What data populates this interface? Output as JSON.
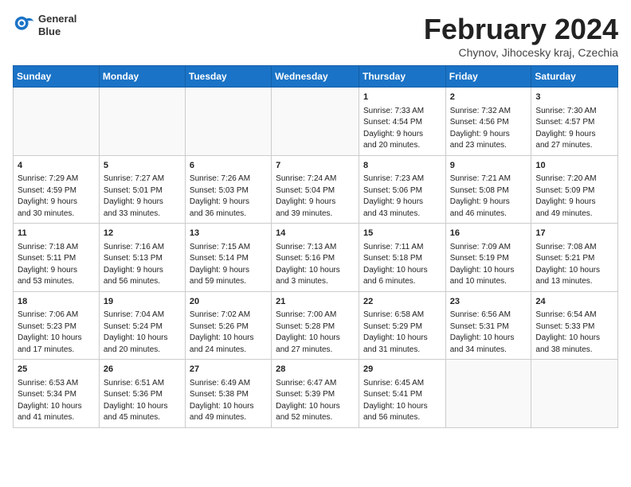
{
  "header": {
    "logo_line1": "General",
    "logo_line2": "Blue",
    "month_year": "February 2024",
    "location": "Chynov, Jihocesky kraj, Czechia"
  },
  "weekdays": [
    "Sunday",
    "Monday",
    "Tuesday",
    "Wednesday",
    "Thursday",
    "Friday",
    "Saturday"
  ],
  "weeks": [
    [
      {
        "day": "",
        "info": ""
      },
      {
        "day": "",
        "info": ""
      },
      {
        "day": "",
        "info": ""
      },
      {
        "day": "",
        "info": ""
      },
      {
        "day": "1",
        "info": "Sunrise: 7:33 AM\nSunset: 4:54 PM\nDaylight: 9 hours\nand 20 minutes."
      },
      {
        "day": "2",
        "info": "Sunrise: 7:32 AM\nSunset: 4:56 PM\nDaylight: 9 hours\nand 23 minutes."
      },
      {
        "day": "3",
        "info": "Sunrise: 7:30 AM\nSunset: 4:57 PM\nDaylight: 9 hours\nand 27 minutes."
      }
    ],
    [
      {
        "day": "4",
        "info": "Sunrise: 7:29 AM\nSunset: 4:59 PM\nDaylight: 9 hours\nand 30 minutes."
      },
      {
        "day": "5",
        "info": "Sunrise: 7:27 AM\nSunset: 5:01 PM\nDaylight: 9 hours\nand 33 minutes."
      },
      {
        "day": "6",
        "info": "Sunrise: 7:26 AM\nSunset: 5:03 PM\nDaylight: 9 hours\nand 36 minutes."
      },
      {
        "day": "7",
        "info": "Sunrise: 7:24 AM\nSunset: 5:04 PM\nDaylight: 9 hours\nand 39 minutes."
      },
      {
        "day": "8",
        "info": "Sunrise: 7:23 AM\nSunset: 5:06 PM\nDaylight: 9 hours\nand 43 minutes."
      },
      {
        "day": "9",
        "info": "Sunrise: 7:21 AM\nSunset: 5:08 PM\nDaylight: 9 hours\nand 46 minutes."
      },
      {
        "day": "10",
        "info": "Sunrise: 7:20 AM\nSunset: 5:09 PM\nDaylight: 9 hours\nand 49 minutes."
      }
    ],
    [
      {
        "day": "11",
        "info": "Sunrise: 7:18 AM\nSunset: 5:11 PM\nDaylight: 9 hours\nand 53 minutes."
      },
      {
        "day": "12",
        "info": "Sunrise: 7:16 AM\nSunset: 5:13 PM\nDaylight: 9 hours\nand 56 minutes."
      },
      {
        "day": "13",
        "info": "Sunrise: 7:15 AM\nSunset: 5:14 PM\nDaylight: 9 hours\nand 59 minutes."
      },
      {
        "day": "14",
        "info": "Sunrise: 7:13 AM\nSunset: 5:16 PM\nDaylight: 10 hours\nand 3 minutes."
      },
      {
        "day": "15",
        "info": "Sunrise: 7:11 AM\nSunset: 5:18 PM\nDaylight: 10 hours\nand 6 minutes."
      },
      {
        "day": "16",
        "info": "Sunrise: 7:09 AM\nSunset: 5:19 PM\nDaylight: 10 hours\nand 10 minutes."
      },
      {
        "day": "17",
        "info": "Sunrise: 7:08 AM\nSunset: 5:21 PM\nDaylight: 10 hours\nand 13 minutes."
      }
    ],
    [
      {
        "day": "18",
        "info": "Sunrise: 7:06 AM\nSunset: 5:23 PM\nDaylight: 10 hours\nand 17 minutes."
      },
      {
        "day": "19",
        "info": "Sunrise: 7:04 AM\nSunset: 5:24 PM\nDaylight: 10 hours\nand 20 minutes."
      },
      {
        "day": "20",
        "info": "Sunrise: 7:02 AM\nSunset: 5:26 PM\nDaylight: 10 hours\nand 24 minutes."
      },
      {
        "day": "21",
        "info": "Sunrise: 7:00 AM\nSunset: 5:28 PM\nDaylight: 10 hours\nand 27 minutes."
      },
      {
        "day": "22",
        "info": "Sunrise: 6:58 AM\nSunset: 5:29 PM\nDaylight: 10 hours\nand 31 minutes."
      },
      {
        "day": "23",
        "info": "Sunrise: 6:56 AM\nSunset: 5:31 PM\nDaylight: 10 hours\nand 34 minutes."
      },
      {
        "day": "24",
        "info": "Sunrise: 6:54 AM\nSunset: 5:33 PM\nDaylight: 10 hours\nand 38 minutes."
      }
    ],
    [
      {
        "day": "25",
        "info": "Sunrise: 6:53 AM\nSunset: 5:34 PM\nDaylight: 10 hours\nand 41 minutes."
      },
      {
        "day": "26",
        "info": "Sunrise: 6:51 AM\nSunset: 5:36 PM\nDaylight: 10 hours\nand 45 minutes."
      },
      {
        "day": "27",
        "info": "Sunrise: 6:49 AM\nSunset: 5:38 PM\nDaylight: 10 hours\nand 49 minutes."
      },
      {
        "day": "28",
        "info": "Sunrise: 6:47 AM\nSunset: 5:39 PM\nDaylight: 10 hours\nand 52 minutes."
      },
      {
        "day": "29",
        "info": "Sunrise: 6:45 AM\nSunset: 5:41 PM\nDaylight: 10 hours\nand 56 minutes."
      },
      {
        "day": "",
        "info": ""
      },
      {
        "day": "",
        "info": ""
      }
    ]
  ]
}
